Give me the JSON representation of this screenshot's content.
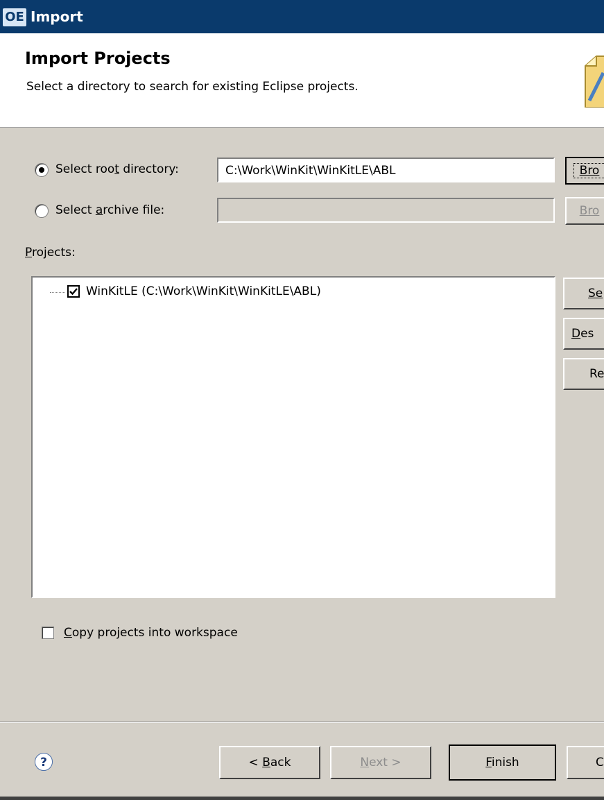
{
  "window": {
    "app_icon": "OE",
    "title": "Import"
  },
  "header": {
    "title": "Import Projects",
    "description": "Select a directory to search for existing Eclipse projects."
  },
  "source": {
    "root_dir": {
      "label_pre": "Select roo",
      "label_acc": "t",
      "label_post": " directory:",
      "value": "C:\\Work\\WinKit\\WinKitLE\\ABL",
      "selected": true
    },
    "archive": {
      "label_pre": "Select ",
      "label_acc": "a",
      "label_post": "rchive file:",
      "value": "",
      "selected": false
    },
    "browse_label_1": "Bro",
    "browse_label_2": "Bro"
  },
  "projects": {
    "label_acc": "P",
    "label_rest": "rojects:",
    "items": [
      {
        "label": "WinKitLE (C:\\Work\\WinKit\\WinKitLE\\ABL)",
        "checked": true
      }
    ],
    "side_buttons": [
      {
        "acc": "Se",
        "rest": ""
      },
      {
        "acc": "D",
        "rest": "es"
      },
      {
        "acc": "",
        "rest": "Re"
      }
    ]
  },
  "options": {
    "copy_acc": "C",
    "copy_rest": "opy projects into workspace",
    "copy_checked": false
  },
  "footer": {
    "help": "?",
    "back_pre": "< ",
    "back_acc": "B",
    "back_rest": "ack",
    "next_acc": "N",
    "next_rest": "ext >",
    "finish_acc": "F",
    "finish_rest": "inish",
    "cancel": "C"
  }
}
